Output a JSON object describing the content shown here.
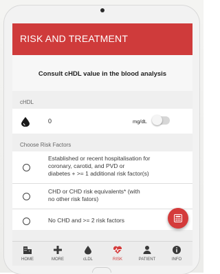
{
  "header": {
    "title": "RISK AND TREATMENT"
  },
  "consult": {
    "text": "Consult cHDL value in the blood analysis"
  },
  "chdl": {
    "label": "cHDL",
    "value": "0",
    "unit": "mg/dL",
    "toggle_on": false,
    "icon": "drop-icon"
  },
  "risk_factors": {
    "label": "Choose Risk Factors",
    "options": [
      {
        "line1": "Established or recent hospitalisation for",
        "line2": "coronary, carotid, and PVD or",
        "line3": "diabetes + >= 1 additional risk factor(s)"
      },
      {
        "line1": "CHD or CHD risk equivalents* (with",
        "line2": "no other risk fators)"
      },
      {
        "line1": "No CHD and >= 2 risk factors"
      }
    ]
  },
  "fab": {
    "icon": "calculator-icon"
  },
  "nav": {
    "items": [
      {
        "label": "HOME",
        "icon": "building-icon"
      },
      {
        "label": "MORE",
        "icon": "plus-icon"
      },
      {
        "label": "cLDL",
        "icon": "drop-icon"
      },
      {
        "label": "RISK",
        "icon": "heartbeat-icon"
      },
      {
        "label": "PATIENT",
        "icon": "person-icon"
      },
      {
        "label": "INFO",
        "icon": "info-icon"
      }
    ],
    "active": "RISK"
  },
  "colors": {
    "brand_red": "#cf3b3b",
    "background": "#efefef",
    "text": "#222222"
  }
}
